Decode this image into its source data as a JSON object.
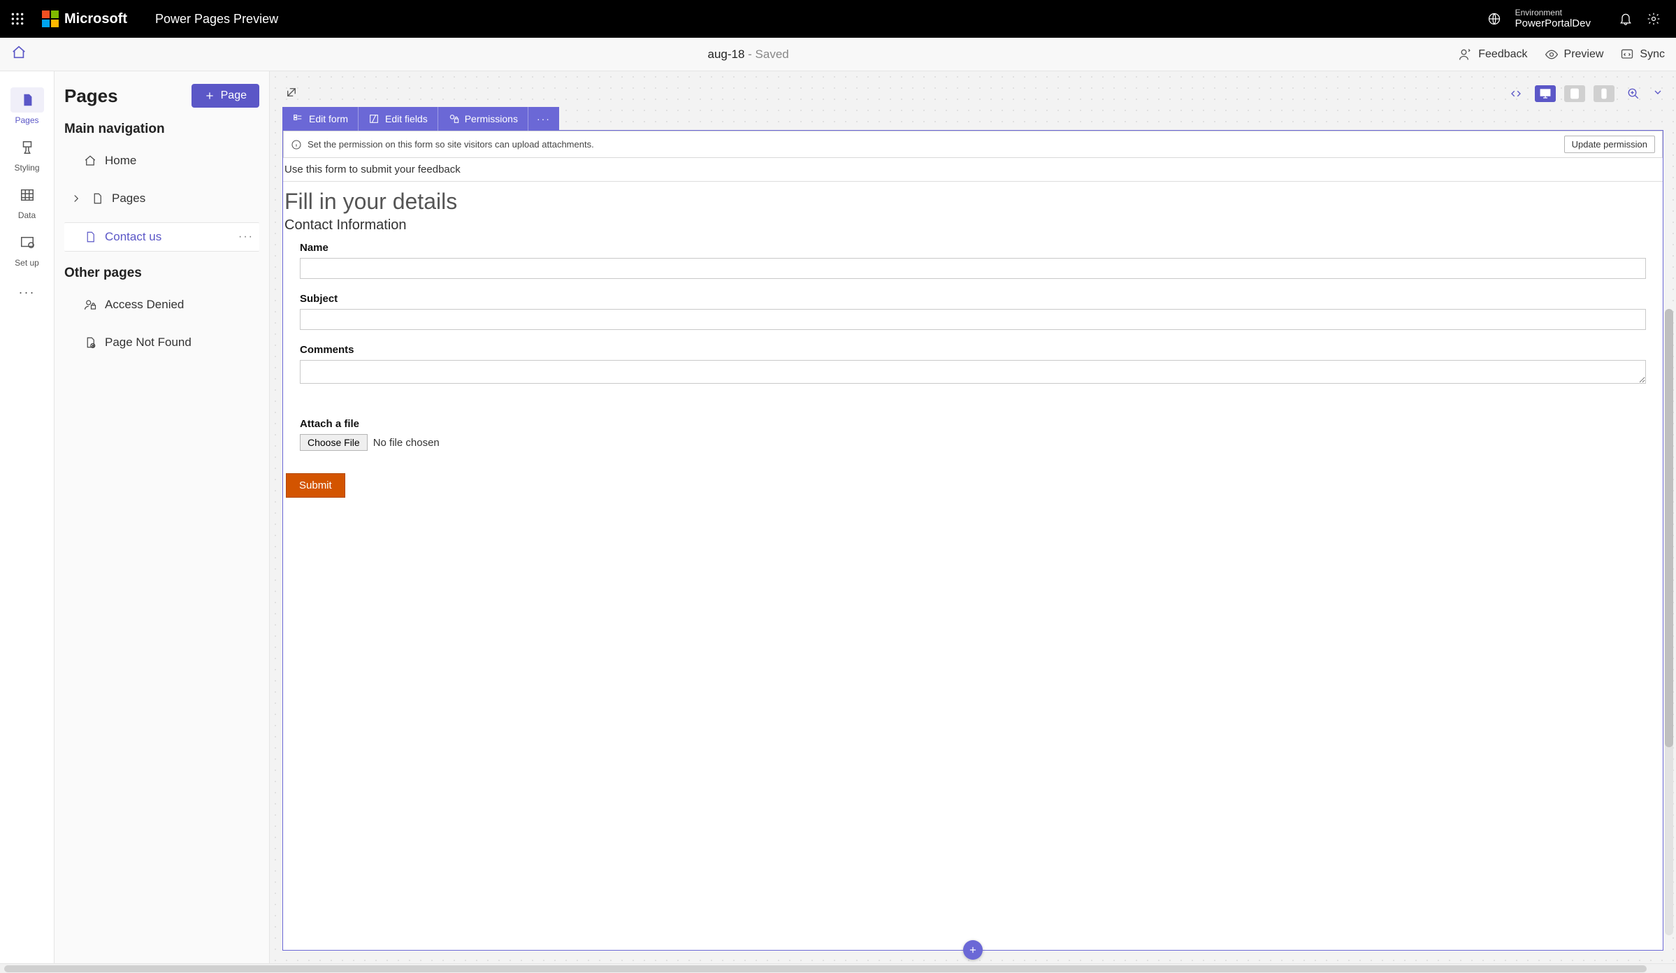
{
  "top": {
    "ms_label": "Microsoft",
    "app_title": "Power Pages Preview",
    "env_label": "Environment",
    "env_name": "PowerPortalDev"
  },
  "cmdbar": {
    "doc_name": "aug-18",
    "doc_status": " - Saved",
    "feedback": "Feedback",
    "preview": "Preview",
    "sync": "Sync"
  },
  "rail": {
    "pages": "Pages",
    "styling": "Styling",
    "data": "Data",
    "setup": "Set up"
  },
  "panel": {
    "title": "Pages",
    "add_page": "Page",
    "section_main": "Main navigation",
    "home": "Home",
    "pages": "Pages",
    "contact": "Contact us",
    "section_other": "Other pages",
    "access_denied": "Access Denied",
    "not_found": "Page Not Found"
  },
  "formbar": {
    "edit_form": "Edit form",
    "edit_fields": "Edit fields",
    "permissions": "Permissions"
  },
  "notice": {
    "text": "Set the permission on this form so site visitors can upload attachments.",
    "button": "Update permission"
  },
  "form": {
    "desc": "Use this form to submit your feedback",
    "h1": "Fill in your details",
    "h2": "Contact Information",
    "name_label": "Name",
    "subject_label": "Subject",
    "comments_label": "Comments",
    "attach_label": "Attach a file",
    "choose_file": "Choose File",
    "no_file": "No file chosen",
    "submit": "Submit"
  }
}
